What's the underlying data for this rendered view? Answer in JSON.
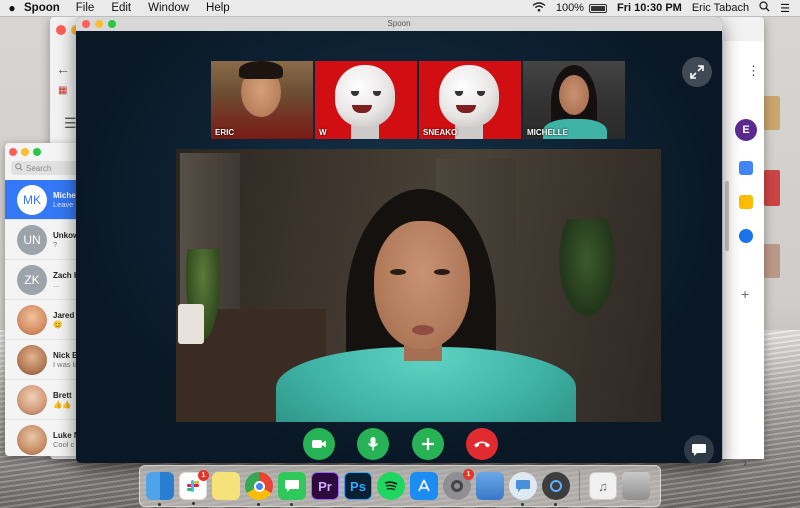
{
  "menubar": {
    "apple": "",
    "app_name": "Spoon",
    "menus": [
      "File",
      "Edit",
      "Window",
      "Help"
    ],
    "battery": "100%",
    "clock": "Fri 10:30 PM",
    "user": "Eric Tabach"
  },
  "spoon": {
    "window_title": "Spoon",
    "participants": [
      {
        "name": "ERIC"
      },
      {
        "name": "W"
      },
      {
        "name": "SNEAKO"
      },
      {
        "name": "MICHELLE"
      }
    ],
    "controls": [
      "camera-icon",
      "microphone-icon",
      "plus-icon",
      "hang-up-icon"
    ],
    "colors": {
      "accept": "#27b255",
      "decline": "#e02b30"
    }
  },
  "messages": {
    "search_placeholder": "Search",
    "conversations": [
      {
        "initials": "MK",
        "name": "Miche",
        "preview": "Leave you th",
        "active": true
      },
      {
        "initials": "UN",
        "name": "Unkow",
        "preview": "?"
      },
      {
        "initials": "ZK",
        "name": "Zach K",
        "preview": "..."
      },
      {
        "initials": "",
        "name": "Jared",
        "preview": "😊"
      },
      {
        "initials": "",
        "name": "Nick B",
        "preview": "I was li started"
      },
      {
        "initials": "",
        "name": "Brett",
        "preview": "👍👍"
      },
      {
        "initials": "",
        "name": "Luke N",
        "preview": "Cool c"
      }
    ]
  },
  "browser": {
    "account_initial": "E"
  },
  "dock": {
    "slack_badge": "1",
    "prefs_badge": "1",
    "premiere_label": "Pr",
    "photoshop_label": "Ps"
  }
}
